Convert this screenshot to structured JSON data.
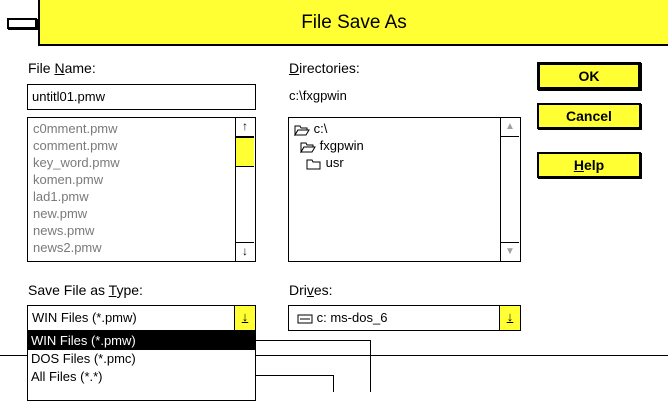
{
  "window": {
    "title": "File Save As"
  },
  "file_name": {
    "label_pre": "File ",
    "label_key": "N",
    "label_post": "ame:",
    "value": "untitl01.pmw"
  },
  "files": [
    "c0mment.pmw",
    "comment.pmw",
    "key_word.pmw",
    "komen.pmw",
    "lad1.pmw",
    "new.pmw",
    "news.pmw",
    "news2.pmw"
  ],
  "directories": {
    "label_key": "D",
    "label_post": "irectories:",
    "path": "c:\\fxgpwin",
    "tree": [
      "c:\\",
      "fxgpwin",
      "usr"
    ]
  },
  "buttons": {
    "ok": "OK",
    "cancel": "Cancel",
    "help_key": "H",
    "help_post": "elp"
  },
  "save_type": {
    "label_pre": "Save File as ",
    "label_key": "T",
    "label_post": "ype:",
    "value": "WIN Files (*.pmw)",
    "options": [
      "WIN Files (*.pmw)",
      "DOS Files (*.pmc)",
      "All Files (*.*)"
    ]
  },
  "drives": {
    "label_pre": "Dri",
    "label_key": "v",
    "label_post": "es:",
    "value": "c: ms-dos_6"
  },
  "colors": {
    "accent": "#ffff33",
    "selection": "#000000"
  }
}
